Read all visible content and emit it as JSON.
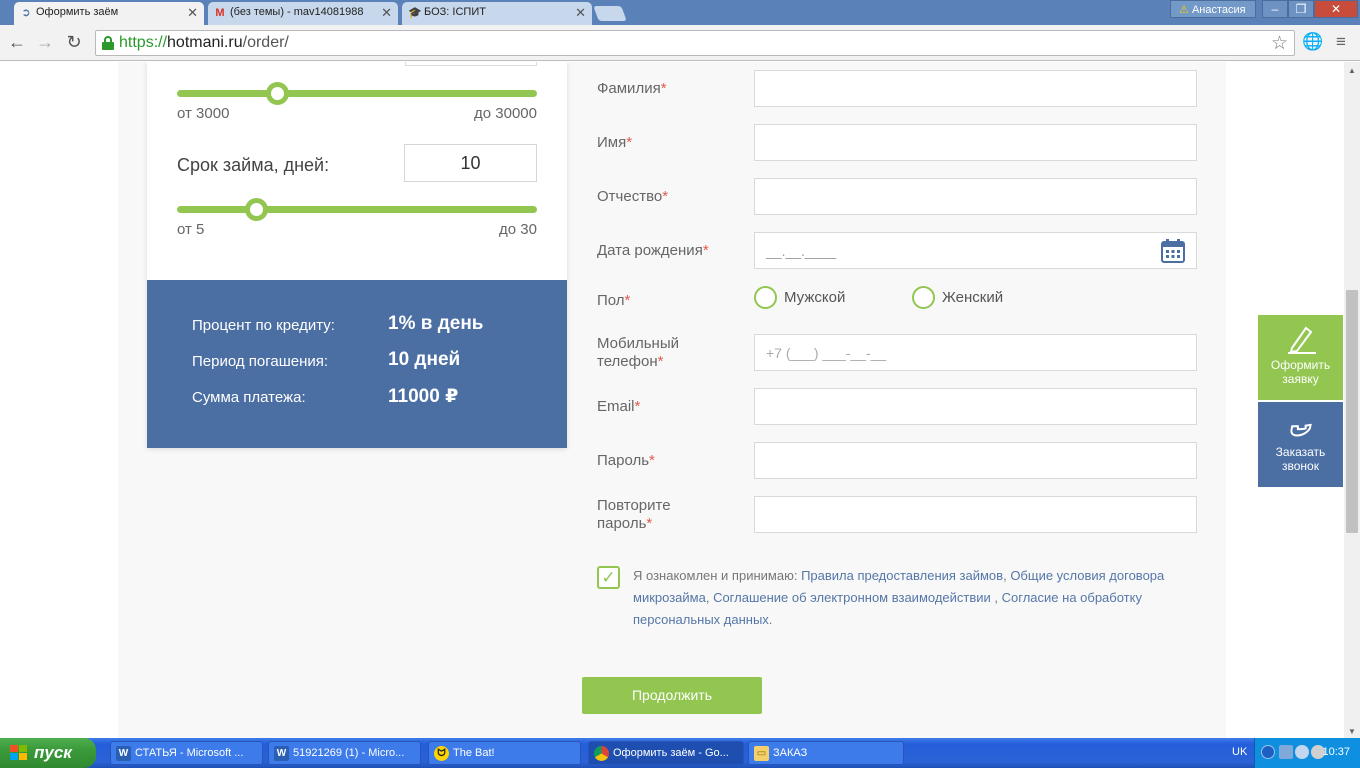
{
  "browser": {
    "tabs": [
      {
        "title": "Оформить заём",
        "icon": "site-favicon"
      },
      {
        "title": "(без темы) - mav14081988",
        "icon": "gmail-icon"
      },
      {
        "title": "БОЗ: ІСПИТ",
        "icon": "graduation-cap-icon"
      }
    ],
    "user": "Анастасия",
    "url_scheme": "https://",
    "url_host": "hotmani.ru",
    "url_path": "/order/"
  },
  "calculator": {
    "amount_min": "от 3000",
    "amount_max": "до 30000",
    "amount_position": 0.28,
    "term_label": "Срок займа, дней:",
    "term_value": "10",
    "term_min": "от 5",
    "term_max": "до 30",
    "term_position": 0.22,
    "summary": [
      {
        "label": "Процент по кредиту:",
        "value": "1% в день"
      },
      {
        "label": "Период погашения:",
        "value": "10 дней"
      },
      {
        "label": "Сумма платежа:",
        "value": "11000 ₽"
      }
    ]
  },
  "form": {
    "required_mark": "*",
    "fields": {
      "surname": {
        "label": "Фамилия",
        "value": ""
      },
      "name": {
        "label": "Имя",
        "value": ""
      },
      "patronymic": {
        "label": "Отчество",
        "value": ""
      },
      "birthdate": {
        "label": "Дата рождения",
        "placeholder": "__.__.____"
      },
      "gender": {
        "label": "Пол",
        "options": [
          "Мужской",
          "Женский"
        ]
      },
      "phone": {
        "label_line1": "Мобильный",
        "label_line2": "телефон",
        "placeholder": "+7 (___) ___-__-__"
      },
      "email": {
        "label": "Email",
        "value": ""
      },
      "password": {
        "label": "Пароль",
        "value": ""
      },
      "password_repeat": {
        "label_line1": "Повторите",
        "label_line2": "пароль",
        "value": ""
      }
    },
    "agreement": {
      "prefix": "Я ознакомлен и принимаю: ",
      "link1": "Правила предоставления займов",
      "sep1": ", ",
      "link2": "Общие условия договора микрозайма",
      "sep2": ", ",
      "link3": "Соглашение об электронном взаимодействии",
      "sep3": " , ",
      "link4": "Согласие на обработку персональных данных",
      "suffix": "."
    },
    "continue_label": "Продолжить"
  },
  "side_buttons": {
    "order_line1": "Оформить",
    "order_line2": "заявку",
    "call_line1": "Заказать",
    "call_line2": "звонок"
  },
  "taskbar": {
    "start_label": "пуск",
    "tasks": [
      {
        "title": "СТАТЬЯ - Microsoft ...",
        "icon": "word-icon"
      },
      {
        "title": "51921269 (1) - Micro...",
        "icon": "word-icon"
      },
      {
        "title": "The Bat!",
        "icon": "bat-icon"
      },
      {
        "title": "Оформить заём - Go...",
        "icon": "chrome-icon"
      },
      {
        "title": "ЗАКАЗ",
        "icon": "folder-icon"
      }
    ],
    "lang": "UK",
    "clock": "10:37"
  },
  "colors": {
    "accent_green": "#92c651",
    "accent_blue": "#4b6ea3",
    "required_red": "#e05a4d",
    "link_blue": "#5577a8"
  }
}
